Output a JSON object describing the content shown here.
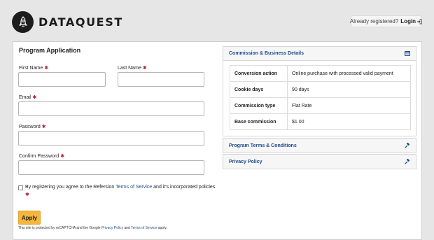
{
  "header": {
    "brand": "DATAQUEST",
    "already_registered": "Already registered?",
    "login_label": "Login"
  },
  "form": {
    "title": "Program Application",
    "first_name_label": "First Name",
    "last_name_label": "Last Name",
    "email_label": "Email",
    "password_label": "Password",
    "confirm_password_label": "Confirm Password",
    "required_mark": "✱",
    "terms_prefix": "By registering you agree to the Refersion",
    "terms_link": "Terms of Service",
    "terms_suffix": "and it's incorporated policies.",
    "apply_label": "Apply",
    "recaptcha_prefix": "This site is protected by reCAPTCHA and the Google",
    "privacy_link": "Privacy Policy",
    "recaptcha_and": "and",
    "tos_link": "Terms of Service",
    "recaptcha_suffix": "apply."
  },
  "commission_panel": {
    "title": "Commission & Business Details",
    "rows": [
      {
        "key": "Conversion action",
        "value": "Online purchase with processed valid payment"
      },
      {
        "key": "Cookie days",
        "value": "90 days"
      },
      {
        "key": "Commission type",
        "value": "Flat Rate"
      },
      {
        "key": "Base commission",
        "value": "$1.00"
      }
    ]
  },
  "terms_panel": {
    "title": "Program Terms & Conditions"
  },
  "privacy_panel": {
    "title": "Privacy Policy"
  },
  "colors": {
    "accent_link": "#1f4a8c",
    "apply_button": "#f5b73b",
    "required": "#b51c2a",
    "logo": "#1c1c1c"
  }
}
